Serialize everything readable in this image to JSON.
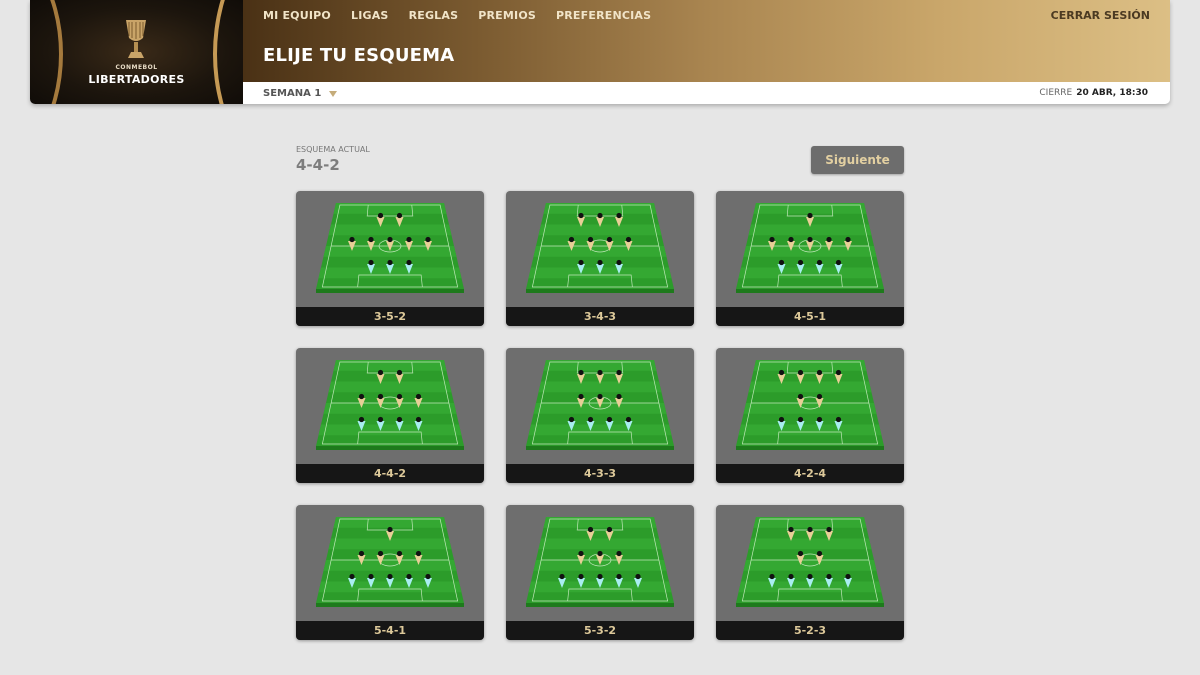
{
  "brand": {
    "small": "CONMEBOL",
    "big": "LIBERTADORES"
  },
  "nav": {
    "items": [
      "MI EQUIPO",
      "LIGAS",
      "REGLAS",
      "PREMIOS",
      "PREFERENCIAS"
    ],
    "logout": "CERRAR SESIÓN"
  },
  "header": {
    "title": "ELIJE TU ESQUEMA",
    "week": "SEMANA 1",
    "deadline_label": "CIERRE",
    "deadline_value": "20 ABR, 18:30"
  },
  "current": {
    "label": "ESQUEMA ACTUAL",
    "value": "4-4-2"
  },
  "next_button": "Siguiente",
  "colors": {
    "forward": "#e8cf96",
    "defender": "#a8eef0",
    "field": "#2c9c2a",
    "card_bg": "#6e6e6e"
  },
  "formations": [
    {
      "label": "3-5-2",
      "rows": [
        2,
        5,
        3
      ]
    },
    {
      "label": "3-4-3",
      "rows": [
        3,
        4,
        3
      ]
    },
    {
      "label": "4-5-1",
      "rows": [
        1,
        5,
        4
      ]
    },
    {
      "label": "4-4-2",
      "rows": [
        2,
        4,
        4
      ]
    },
    {
      "label": "4-3-3",
      "rows": [
        3,
        3,
        4
      ]
    },
    {
      "label": "4-2-4",
      "rows": [
        4,
        2,
        4
      ]
    },
    {
      "label": "5-4-1",
      "rows": [
        1,
        4,
        5
      ]
    },
    {
      "label": "5-3-2",
      "rows": [
        2,
        3,
        5
      ]
    },
    {
      "label": "5-2-3",
      "rows": [
        3,
        2,
        5
      ]
    }
  ]
}
